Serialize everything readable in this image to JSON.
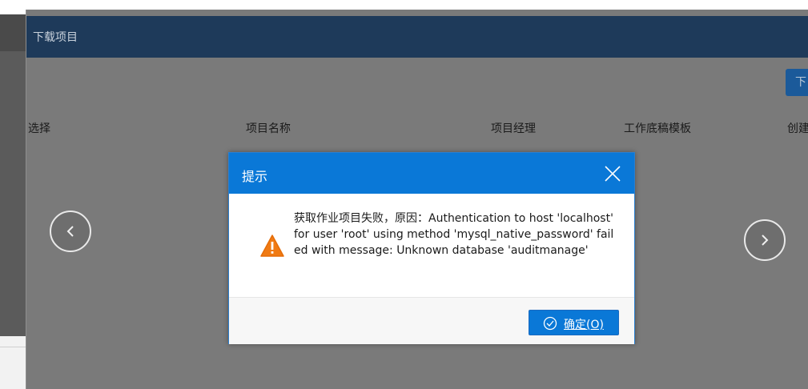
{
  "window": {
    "title": "下载项目",
    "download_button_partial": "下"
  },
  "table": {
    "columns": [
      "选择",
      "项目名称",
      "项目经理",
      "工作底稿模板",
      "创建"
    ]
  },
  "dialog": {
    "title": "提示",
    "message": "获取作业项目失败，原因：Authentication to host 'localhost' for user 'root' using method 'mysql_native_password' failed with message: Unknown database 'auditmanage'",
    "ok_label": "确定(O)",
    "icons": {
      "close": "close-icon",
      "warning": "warning-icon",
      "ok": "check-circle-icon"
    }
  },
  "navigation": {
    "prev_icon": "chevron-left-icon",
    "next_icon": "chevron-right-icon"
  },
  "colors": {
    "window_header": "#1e3a5a",
    "dialog_header": "#0a78d7",
    "warning": "#f07a13"
  }
}
